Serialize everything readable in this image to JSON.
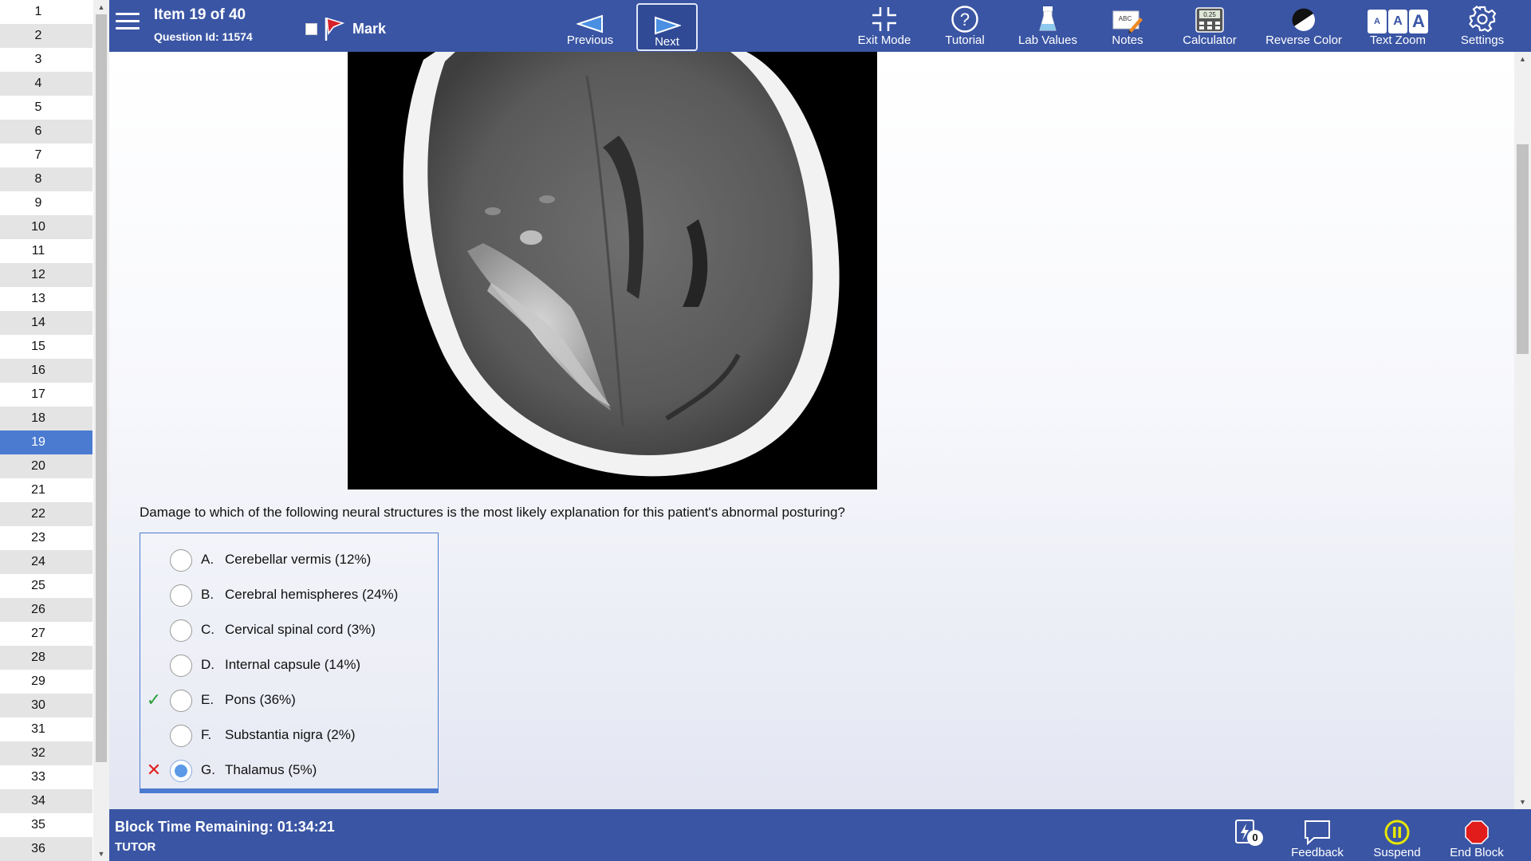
{
  "nav": {
    "items": [
      "1",
      "2",
      "3",
      "4",
      "5",
      "6",
      "7",
      "8",
      "9",
      "10",
      "11",
      "12",
      "13",
      "14",
      "15",
      "16",
      "17",
      "18",
      "19",
      "20",
      "21",
      "22",
      "23",
      "24",
      "25",
      "26",
      "27",
      "28",
      "29",
      "30",
      "31",
      "32",
      "33",
      "34",
      "35",
      "36"
    ],
    "current": "19"
  },
  "toolbar": {
    "item_title": "Item 19 of 40",
    "question_id": "Question Id: 11574",
    "mark_label": "Mark",
    "previous_label": "Previous",
    "next_label": "Next",
    "exit_mode_label": "Exit Mode",
    "tutorial_label": "Tutorial",
    "lab_values_label": "Lab Values",
    "notes_label": "Notes",
    "calculator_label": "Calculator",
    "reverse_color_label": "Reverse Color",
    "text_zoom_label": "Text Zoom",
    "settings_label": "Settings",
    "icons": {
      "menu": "hamburger-menu-icon",
      "mark": "red-flag-icon",
      "previous": "left-triangle-arrow-icon",
      "next": "right-triangle-arrow-icon",
      "exit_mode": "compress-icon",
      "tutorial": "question-circle-icon",
      "lab_values": "flask-icon",
      "notes": "notepad-pencil-icon",
      "calculator": "calculator-icon",
      "reverse_color": "half-circle-contrast-icon",
      "text_zoom": "text-size-icon",
      "settings": "gear-icon"
    },
    "text_zoom_glyphs": [
      "A",
      "A",
      "A"
    ],
    "calculator_display": "0.25",
    "notes_glyph": "ABC"
  },
  "question": {
    "text": "Damage to which of the following neural structures is the most likely explanation for this patient's abnormal posturing?",
    "choices": [
      {
        "letter": "A.",
        "text": "Cerebellar vermis (12%)",
        "status": "",
        "selected": false
      },
      {
        "letter": "B.",
        "text": "Cerebral hemispheres (24%)",
        "status": "",
        "selected": false
      },
      {
        "letter": "C.",
        "text": "Cervical spinal cord (3%)",
        "status": "",
        "selected": false
      },
      {
        "letter": "D.",
        "text": "Internal capsule (14%)",
        "status": "",
        "selected": false
      },
      {
        "letter": "E.",
        "text": "Pons (36%)",
        "status": "correct",
        "selected": false
      },
      {
        "letter": "F.",
        "text": "Substantia nigra (2%)",
        "status": "",
        "selected": false
      },
      {
        "letter": "G.",
        "text": "Thalamus (5%)",
        "status": "incorrect",
        "selected": true
      }
    ],
    "correct_mark": "✓",
    "incorrect_mark": "✕"
  },
  "footer": {
    "time_remaining": "Block Time Remaining: 01:34:21",
    "mode": "TUTOR",
    "flash_count": "0",
    "feedback_label": "Feedback",
    "suspend_label": "Suspend",
    "end_block_label": "End Block",
    "icons": {
      "flash_cards": "lightning-card-icon",
      "feedback": "speech-bubble-icon",
      "suspend": "pause-circle-icon",
      "end_block": "stop-octagon-icon"
    }
  },
  "colors": {
    "toolbar_bg": "#3a55a4",
    "nav_current": "#4a7bd0",
    "correct": "#2e9e3a",
    "incorrect": "#e02020",
    "suspend": "#e6e600",
    "end_block": "#e21b1b",
    "flag": "#d6202a"
  }
}
